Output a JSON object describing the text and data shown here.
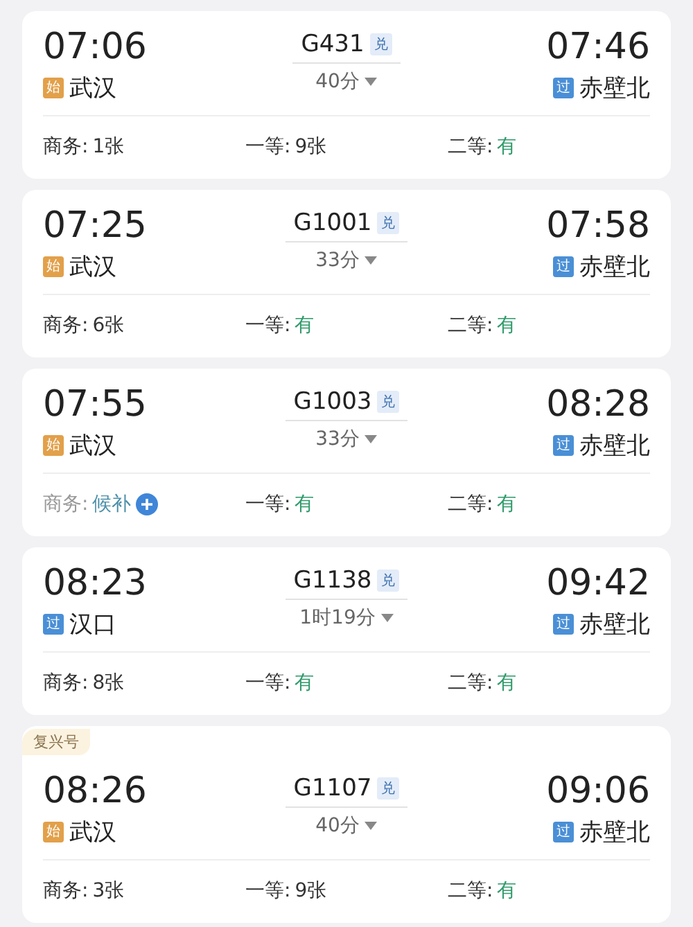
{
  "trains": [
    {
      "departure": {
        "time": "07:06",
        "tag": {
          "kind": "start",
          "text": "始"
        },
        "station": "武汉"
      },
      "train_no": "G431",
      "ticket_badge": "兑",
      "duration": "40分",
      "arrival": {
        "time": "07:46",
        "tag": {
          "kind": "pass",
          "text": "过"
        },
        "station": "赤壁北"
      },
      "seats": [
        {
          "label": "商务:",
          "value": "1张",
          "kind": "count"
        },
        {
          "label": "一等:",
          "value": "9张",
          "kind": "count"
        },
        {
          "label": "二等:",
          "value": "有",
          "kind": "available"
        }
      ]
    },
    {
      "departure": {
        "time": "07:25",
        "tag": {
          "kind": "start",
          "text": "始"
        },
        "station": "武汉"
      },
      "train_no": "G1001",
      "ticket_badge": "兑",
      "duration": "33分",
      "arrival": {
        "time": "07:58",
        "tag": {
          "kind": "pass",
          "text": "过"
        },
        "station": "赤壁北"
      },
      "seats": [
        {
          "label": "商务:",
          "value": "6张",
          "kind": "count"
        },
        {
          "label": "一等:",
          "value": "有",
          "kind": "available"
        },
        {
          "label": "二等:",
          "value": "有",
          "kind": "available"
        }
      ]
    },
    {
      "departure": {
        "time": "07:55",
        "tag": {
          "kind": "start",
          "text": "始"
        },
        "station": "武汉"
      },
      "train_no": "G1003",
      "ticket_badge": "兑",
      "duration": "33分",
      "arrival": {
        "time": "08:28",
        "tag": {
          "kind": "pass",
          "text": "过"
        },
        "station": "赤壁北"
      },
      "seats": [
        {
          "label": "商务:",
          "value": "候补",
          "kind": "waitlist"
        },
        {
          "label": "一等:",
          "value": "有",
          "kind": "available"
        },
        {
          "label": "二等:",
          "value": "有",
          "kind": "available"
        }
      ]
    },
    {
      "departure": {
        "time": "08:23",
        "tag": {
          "kind": "pass",
          "text": "过"
        },
        "station": "汉口"
      },
      "train_no": "G1138",
      "ticket_badge": "兑",
      "duration": "1时19分",
      "arrival": {
        "time": "09:42",
        "tag": {
          "kind": "pass",
          "text": "过"
        },
        "station": "赤壁北"
      },
      "seats": [
        {
          "label": "商务:",
          "value": "8张",
          "kind": "count"
        },
        {
          "label": "一等:",
          "value": "有",
          "kind": "available"
        },
        {
          "label": "二等:",
          "value": "有",
          "kind": "available"
        }
      ]
    },
    {
      "brand_badge": "复兴号",
      "departure": {
        "time": "08:26",
        "tag": {
          "kind": "start",
          "text": "始"
        },
        "station": "武汉"
      },
      "train_no": "G1107",
      "ticket_badge": "兑",
      "duration": "40分",
      "arrival": {
        "time": "09:06",
        "tag": {
          "kind": "pass",
          "text": "过"
        },
        "station": "赤壁北"
      },
      "seats": [
        {
          "label": "商务:",
          "value": "3张",
          "kind": "count"
        },
        {
          "label": "一等:",
          "value": "9张",
          "kind": "count"
        },
        {
          "label": "二等:",
          "value": "有",
          "kind": "available"
        }
      ]
    }
  ]
}
